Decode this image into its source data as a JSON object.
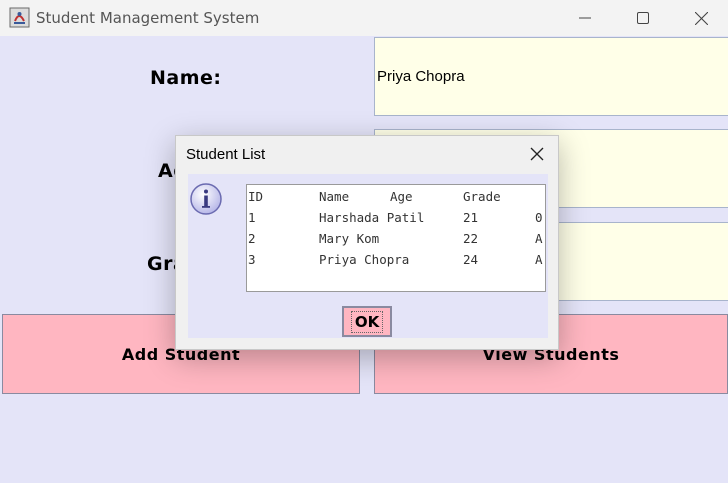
{
  "window": {
    "title": "Student Management System"
  },
  "form": {
    "name_label": "Name:",
    "age_label": "Age:",
    "grade_label": "Grade:",
    "name_value": "Priya Chopra",
    "age_value": "",
    "grade_value": ""
  },
  "buttons": {
    "add_label": "Add Student",
    "view_label": "View Students"
  },
  "dialog": {
    "title": "Student List",
    "ok_label": "OK",
    "columns": [
      "ID",
      "Name",
      "Age",
      "Grade"
    ],
    "rows": [
      [
        "1",
        "Harshada Patil",
        "21",
        "0"
      ],
      [
        "2",
        "Mary Kom",
        "22",
        "A"
      ],
      [
        "3",
        "Priya Chopra",
        "24",
        "A"
      ]
    ]
  },
  "colors": {
    "content_bg": "#e4e4f8",
    "field_bg": "#ffffe8",
    "button_bg": "#ffb6c1"
  },
  "icons": {
    "app": "java-app-icon",
    "info": "info-icon",
    "close": "close-icon",
    "minimize": "minimize-icon",
    "maximize": "maximize-icon"
  }
}
